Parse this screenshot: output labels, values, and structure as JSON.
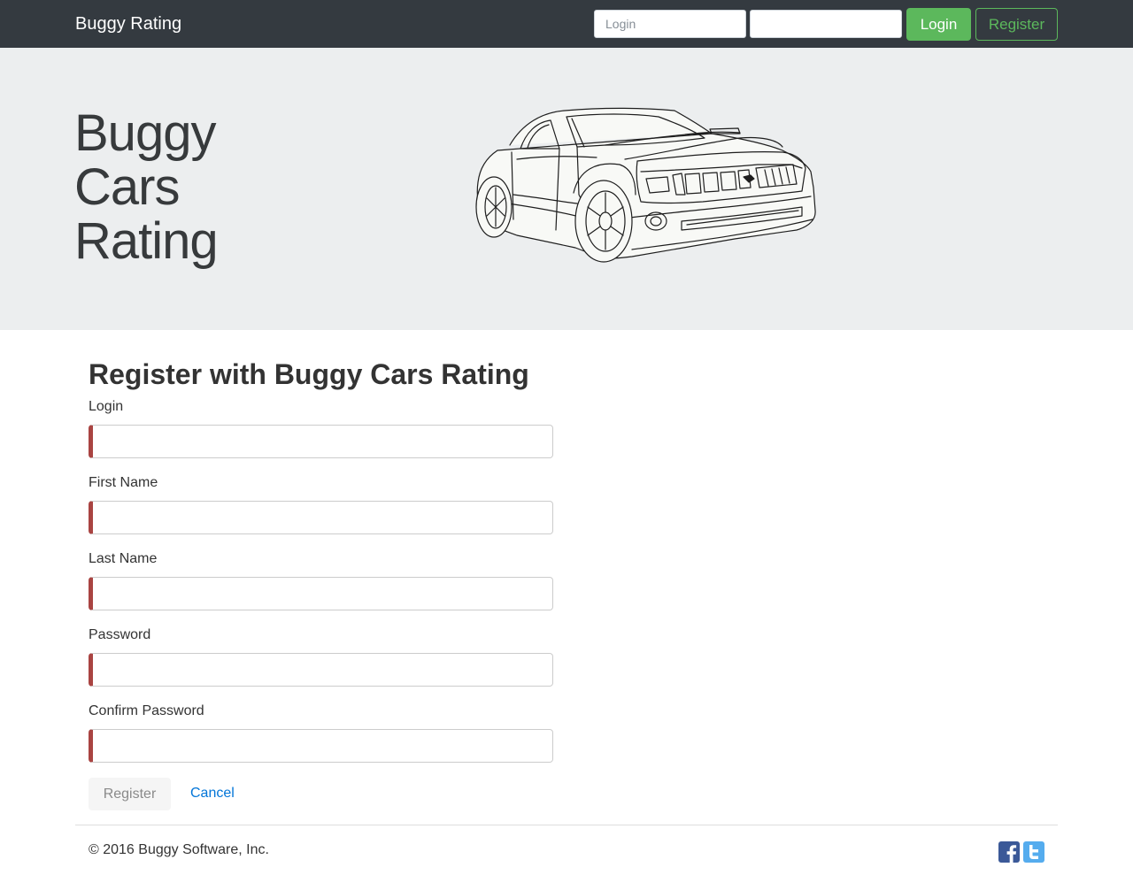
{
  "navbar": {
    "brand": "Buggy Rating",
    "login_placeholder": "Login",
    "password_value": "",
    "login_button": "Login",
    "register_button": "Register",
    "accent_color": "#5cb85c",
    "background_color": "#343a40"
  },
  "hero": {
    "title_lines": [
      "Buggy",
      "Cars",
      "Rating"
    ],
    "image": "car-line-drawing"
  },
  "form": {
    "title": "Register with Buggy Cars Rating",
    "fields": [
      {
        "label": "Login",
        "value": ""
      },
      {
        "label": "First Name",
        "value": ""
      },
      {
        "label": "Last Name",
        "value": ""
      },
      {
        "label": "Password",
        "value": ""
      },
      {
        "label": "Confirm Password",
        "value": ""
      }
    ],
    "invalid_color": "#a94442",
    "register_button": "Register",
    "cancel_link": "Cancel"
  },
  "footer": {
    "copyright": "© 2016 Buggy Software, Inc.",
    "social_icons": [
      "facebook-icon",
      "twitter-icon"
    ]
  }
}
